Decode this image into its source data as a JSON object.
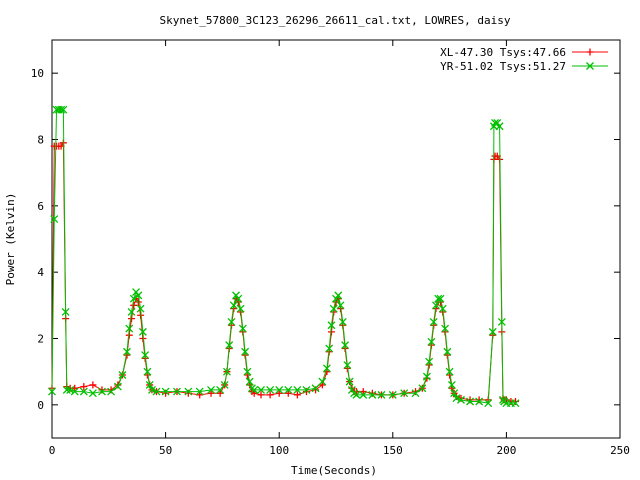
{
  "chart_data": {
    "type": "scatter",
    "title": "Skynet_57800_3C123_26296_26611_cal.txt, LOWRES, daisy",
    "xlabel": "Time(Seconds)",
    "ylabel": "Power (Kelvin)",
    "xlim": [
      0,
      250
    ],
    "ylim": [
      -1,
      11
    ],
    "xticks": [
      0,
      50,
      100,
      150,
      200,
      250
    ],
    "yticks": [
      0,
      2,
      4,
      6,
      8,
      10
    ],
    "grid": false,
    "legend_position": "top-right",
    "series": [
      {
        "name": "XL-47.30 Tsys:47.66",
        "color": "#ff0000",
        "marker": "plus",
        "x": [
          0,
          1,
          2,
          3,
          4,
          5,
          6,
          6.5,
          8,
          10,
          14,
          18,
          22,
          26,
          29,
          31,
          33,
          34,
          35,
          36,
          37,
          38,
          39,
          40,
          41,
          42,
          43,
          44,
          46,
          50,
          55,
          60,
          65,
          70,
          74,
          76,
          77,
          78,
          79,
          80,
          81,
          82,
          83,
          84,
          85,
          86,
          87,
          88,
          89,
          92,
          96,
          100,
          104,
          108,
          112,
          116,
          119,
          121,
          122,
          123,
          124,
          125,
          126,
          127,
          128,
          129,
          130,
          131,
          132,
          133,
          134,
          137,
          141,
          145,
          150,
          155,
          160,
          163,
          165,
          166,
          167,
          168,
          169,
          170,
          171,
          172,
          173,
          174,
          175,
          176,
          177,
          178,
          180,
          184,
          188,
          192,
          194,
          194.5,
          195,
          196,
          197,
          198,
          198.5,
          199,
          200,
          202,
          204
        ],
        "y": [
          0.5,
          7.8,
          7.8,
          7.8,
          7.8,
          7.9,
          2.6,
          0.55,
          0.5,
          0.5,
          0.55,
          0.6,
          0.45,
          0.45,
          0.6,
          0.9,
          1.5,
          2.1,
          2.6,
          3.0,
          3.2,
          3.1,
          2.7,
          2.0,
          1.4,
          0.9,
          0.6,
          0.45,
          0.4,
          0.35,
          0.4,
          0.35,
          0.3,
          0.35,
          0.35,
          0.6,
          1.0,
          1.7,
          2.4,
          2.9,
          3.2,
          3.1,
          2.8,
          2.2,
          1.5,
          0.9,
          0.6,
          0.4,
          0.35,
          0.3,
          0.3,
          0.35,
          0.35,
          0.3,
          0.4,
          0.45,
          0.6,
          1.0,
          1.6,
          2.2,
          2.8,
          3.1,
          3.2,
          2.9,
          2.4,
          1.7,
          1.1,
          0.7,
          0.5,
          0.4,
          0.4,
          0.4,
          0.35,
          0.3,
          0.3,
          0.35,
          0.4,
          0.5,
          0.8,
          1.2,
          1.8,
          2.4,
          2.9,
          3.1,
          3.1,
          2.8,
          2.2,
          1.5,
          0.9,
          0.5,
          0.35,
          0.25,
          0.2,
          0.15,
          0.15,
          0.15,
          2.1,
          7.4,
          7.5,
          7.5,
          7.4,
          2.2,
          0.2,
          0.15,
          0.15,
          0.1,
          0.1
        ]
      },
      {
        "name": "YR-51.02 Tsys:51.27",
        "color": "#00c000",
        "marker": "x",
        "x": [
          0,
          1,
          2,
          3,
          4,
          5,
          6,
          6.5,
          8,
          10,
          14,
          18,
          22,
          26,
          29,
          31,
          33,
          34,
          35,
          36,
          37,
          38,
          39,
          40,
          41,
          42,
          43,
          44,
          46,
          50,
          55,
          60,
          65,
          70,
          74,
          76,
          77,
          78,
          79,
          80,
          81,
          82,
          83,
          84,
          85,
          86,
          87,
          88,
          89,
          92,
          96,
          100,
          104,
          108,
          112,
          116,
          119,
          121,
          122,
          123,
          124,
          125,
          126,
          127,
          128,
          129,
          130,
          131,
          132,
          133,
          134,
          137,
          141,
          145,
          150,
          155,
          160,
          163,
          165,
          166,
          167,
          168,
          169,
          170,
          171,
          172,
          173,
          174,
          175,
          176,
          177,
          178,
          180,
          184,
          188,
          192,
          194,
          194.5,
          195,
          196,
          197,
          198,
          198.5,
          199,
          200,
          202,
          204
        ],
        "y": [
          0.4,
          5.6,
          8.9,
          8.9,
          8.9,
          8.9,
          2.8,
          0.45,
          0.45,
          0.4,
          0.4,
          0.35,
          0.4,
          0.4,
          0.55,
          0.9,
          1.6,
          2.3,
          2.8,
          3.2,
          3.4,
          3.3,
          2.9,
          2.2,
          1.5,
          1.0,
          0.6,
          0.45,
          0.4,
          0.4,
          0.4,
          0.4,
          0.4,
          0.45,
          0.45,
          0.6,
          1.0,
          1.8,
          2.5,
          3.0,
          3.3,
          3.2,
          2.9,
          2.3,
          1.6,
          1.0,
          0.7,
          0.5,
          0.45,
          0.45,
          0.45,
          0.45,
          0.45,
          0.45,
          0.45,
          0.5,
          0.7,
          1.1,
          1.7,
          2.4,
          2.9,
          3.2,
          3.3,
          3.0,
          2.5,
          1.8,
          1.2,
          0.7,
          0.45,
          0.35,
          0.3,
          0.3,
          0.3,
          0.3,
          0.3,
          0.35,
          0.35,
          0.5,
          0.85,
          1.3,
          1.9,
          2.5,
          3.0,
          3.2,
          3.2,
          2.9,
          2.3,
          1.6,
          1.0,
          0.6,
          0.35,
          0.2,
          0.15,
          0.1,
          0.1,
          0.05,
          2.2,
          8.4,
          8.5,
          8.5,
          8.4,
          2.5,
          0.15,
          0.1,
          0.05,
          0.05,
          0.05
        ]
      }
    ]
  }
}
